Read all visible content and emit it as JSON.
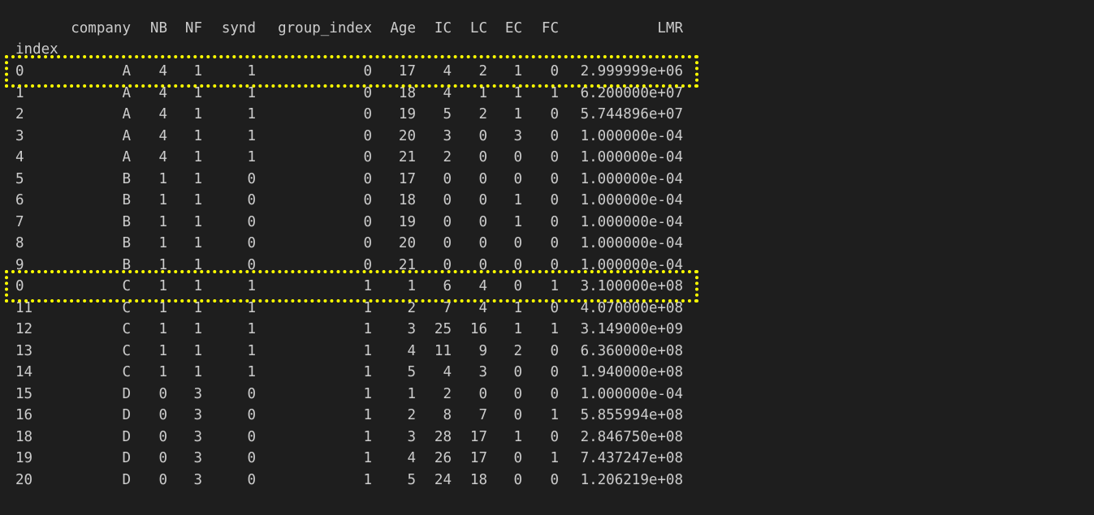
{
  "terminal": {
    "background": "#1e1e1e",
    "text_color": "#cccccc",
    "highlight_color": "#ffff00"
  },
  "header": {
    "columns": [
      "company",
      "NB",
      "NF",
      "synd",
      "group_index",
      "Age",
      "IC",
      "LC",
      "EC",
      "FC",
      "LMR"
    ],
    "index_label": "index"
  },
  "rows": [
    {
      "index": "0",
      "company": "A",
      "NB": "4",
      "NF": "1",
      "synd": "1",
      "group_index": "0",
      "Age": "17",
      "IC": "4",
      "LC": "2",
      "EC": "1",
      "FC": "0",
      "LMR": "2.999999e+06"
    },
    {
      "index": "1",
      "company": "A",
      "NB": "4",
      "NF": "1",
      "synd": "1",
      "group_index": "0",
      "Age": "18",
      "IC": "4",
      "LC": "1",
      "EC": "1",
      "FC": "1",
      "LMR": "6.200000e+07"
    },
    {
      "index": "2",
      "company": "A",
      "NB": "4",
      "NF": "1",
      "synd": "1",
      "group_index": "0",
      "Age": "19",
      "IC": "5",
      "LC": "2",
      "EC": "1",
      "FC": "0",
      "LMR": "5.744896e+07"
    },
    {
      "index": "3",
      "company": "A",
      "NB": "4",
      "NF": "1",
      "synd": "1",
      "group_index": "0",
      "Age": "20",
      "IC": "3",
      "LC": "0",
      "EC": "3",
      "FC": "0",
      "LMR": "1.000000e-04"
    },
    {
      "index": "4",
      "company": "A",
      "NB": "4",
      "NF": "1",
      "synd": "1",
      "group_index": "0",
      "Age": "21",
      "IC": "2",
      "LC": "0",
      "EC": "0",
      "FC": "0",
      "LMR": "1.000000e-04"
    },
    {
      "index": "5",
      "company": "B",
      "NB": "1",
      "NF": "1",
      "synd": "0",
      "group_index": "0",
      "Age": "17",
      "IC": "0",
      "LC": "0",
      "EC": "0",
      "FC": "0",
      "LMR": "1.000000e-04"
    },
    {
      "index": "6",
      "company": "B",
      "NB": "1",
      "NF": "1",
      "synd": "0",
      "group_index": "0",
      "Age": "18",
      "IC": "0",
      "LC": "0",
      "EC": "1",
      "FC": "0",
      "LMR": "1.000000e-04"
    },
    {
      "index": "7",
      "company": "B",
      "NB": "1",
      "NF": "1",
      "synd": "0",
      "group_index": "0",
      "Age": "19",
      "IC": "0",
      "LC": "0",
      "EC": "1",
      "FC": "0",
      "LMR": "1.000000e-04"
    },
    {
      "index": "8",
      "company": "B",
      "NB": "1",
      "NF": "1",
      "synd": "0",
      "group_index": "0",
      "Age": "20",
      "IC": "0",
      "LC": "0",
      "EC": "0",
      "FC": "0",
      "LMR": "1.000000e-04"
    },
    {
      "index": "9",
      "company": "B",
      "NB": "1",
      "NF": "1",
      "synd": "0",
      "group_index": "0",
      "Age": "21",
      "IC": "0",
      "LC": "0",
      "EC": "0",
      "FC": "0",
      "LMR": "1.000000e-04"
    },
    {
      "index": "0",
      "company": "C",
      "NB": "1",
      "NF": "1",
      "synd": "1",
      "group_index": "1",
      "Age": "1",
      "IC": "6",
      "LC": "4",
      "EC": "0",
      "FC": "1",
      "LMR": "3.100000e+08"
    },
    {
      "index": "11",
      "company": "C",
      "NB": "1",
      "NF": "1",
      "synd": "1",
      "group_index": "1",
      "Age": "2",
      "IC": "7",
      "LC": "4",
      "EC": "1",
      "FC": "0",
      "LMR": "4.070000e+08"
    },
    {
      "index": "12",
      "company": "C",
      "NB": "1",
      "NF": "1",
      "synd": "1",
      "group_index": "1",
      "Age": "3",
      "IC": "25",
      "LC": "16",
      "EC": "1",
      "FC": "1",
      "LMR": "3.149000e+09"
    },
    {
      "index": "13",
      "company": "C",
      "NB": "1",
      "NF": "1",
      "synd": "1",
      "group_index": "1",
      "Age": "4",
      "IC": "11",
      "LC": "9",
      "EC": "2",
      "FC": "0",
      "LMR": "6.360000e+08"
    },
    {
      "index": "14",
      "company": "C",
      "NB": "1",
      "NF": "1",
      "synd": "1",
      "group_index": "1",
      "Age": "5",
      "IC": "4",
      "LC": "3",
      "EC": "0",
      "FC": "0",
      "LMR": "1.940000e+08"
    },
    {
      "index": "15",
      "company": "D",
      "NB": "0",
      "NF": "3",
      "synd": "0",
      "group_index": "1",
      "Age": "1",
      "IC": "2",
      "LC": "0",
      "EC": "0",
      "FC": "0",
      "LMR": "1.000000e-04"
    },
    {
      "index": "16",
      "company": "D",
      "NB": "0",
      "NF": "3",
      "synd": "0",
      "group_index": "1",
      "Age": "2",
      "IC": "8",
      "LC": "7",
      "EC": "0",
      "FC": "1",
      "LMR": "5.855994e+08"
    },
    {
      "index": "18",
      "company": "D",
      "NB": "0",
      "NF": "3",
      "synd": "0",
      "group_index": "1",
      "Age": "3",
      "IC": "28",
      "LC": "17",
      "EC": "1",
      "FC": "0",
      "LMR": "2.846750e+08"
    },
    {
      "index": "19",
      "company": "D",
      "NB": "0",
      "NF": "3",
      "synd": "0",
      "group_index": "1",
      "Age": "4",
      "IC": "26",
      "LC": "17",
      "EC": "0",
      "FC": "1",
      "LMR": "7.437247e+08"
    },
    {
      "index": "20",
      "company": "D",
      "NB": "0",
      "NF": "3",
      "synd": "0",
      "group_index": "1",
      "Age": "5",
      "IC": "24",
      "LC": "18",
      "EC": "0",
      "FC": "0",
      "LMR": "1.206219e+08"
    }
  ],
  "highlighted_rows": [
    0,
    10
  ]
}
